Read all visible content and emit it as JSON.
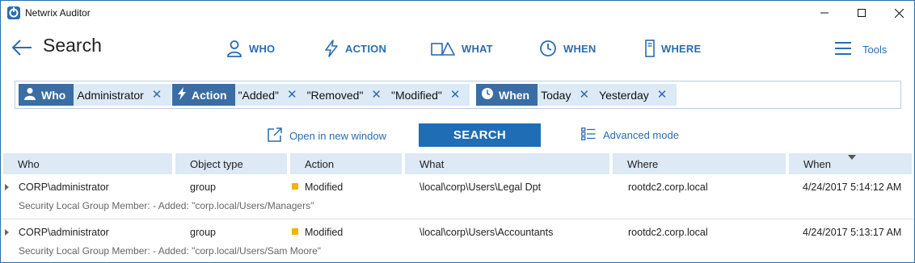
{
  "window": {
    "title": "Netwrix Auditor",
    "accent": "#2b6cb0"
  },
  "header": {
    "title": "Search",
    "tabs": [
      {
        "label": "WHO",
        "icon": "person-icon"
      },
      {
        "label": "ACTION",
        "icon": "lightning-icon"
      },
      {
        "label": "WHAT",
        "icon": "objects-icon"
      },
      {
        "label": "WHEN",
        "icon": "clock-icon"
      },
      {
        "label": "WHERE",
        "icon": "server-icon"
      }
    ],
    "tools_label": "Tools"
  },
  "filters": {
    "who": {
      "label": "Who",
      "values": [
        "Administrator"
      ]
    },
    "action": {
      "label": "Action",
      "values": [
        "\"Added\"",
        "\"Removed\"",
        "\"Modified\""
      ]
    },
    "when": {
      "label": "When",
      "values": [
        "Today",
        "Yesterday"
      ]
    },
    "remove_glyph": "✕"
  },
  "actions": {
    "open_new_window": "Open in new window",
    "search": "SEARCH",
    "advanced_mode": "Advanced mode"
  },
  "table": {
    "columns": [
      "Who",
      "Object type",
      "Action",
      "What",
      "Where",
      "When"
    ],
    "rows": [
      {
        "who": "CORP\\administrator",
        "object_type": "group",
        "action": "Modified",
        "what": "\\local\\corp\\Users\\Legal Dpt",
        "where": "rootdc2.corp.local",
        "when": "4/24/2017 5:14:12 AM",
        "details": "Security Local Group Member: - Added: \"corp.local/Users/Managers\""
      },
      {
        "who": "CORP\\administrator",
        "object_type": "group",
        "action": "Modified",
        "what": "\\local\\corp\\Users\\Accountants",
        "where": "rootdc2.corp.local",
        "when": "4/24/2017 5:13:17 AM",
        "details": "Security Local Group Member: - Added: \"corp.local/Users/Sam Moore\""
      }
    ]
  }
}
